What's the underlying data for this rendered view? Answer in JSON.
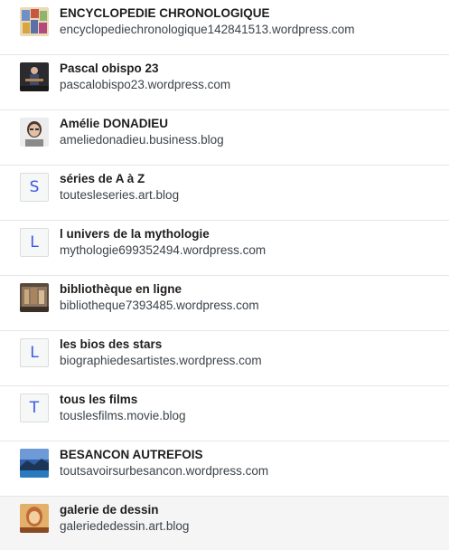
{
  "sites": [
    {
      "title": "ENCYCLOPEDIE CHRONOLOGIQUE",
      "url": "encyclopediechronologique142841513.wordpress.com",
      "thumb": "image",
      "thumb_name": "encyclopedie-thumbnail"
    },
    {
      "title": "Pascal obispo 23",
      "url": "pascalobispo23.wordpress.com",
      "thumb": "image",
      "thumb_name": "guitarist-thumbnail"
    },
    {
      "title": "Amélie DONADIEU",
      "url": "ameliedonadieu.business.blog",
      "thumb": "image",
      "thumb_name": "portrait-thumbnail"
    },
    {
      "title": "séries de A à Z",
      "url": "toutesleseries.art.blog",
      "thumb": "letter",
      "letter": "S"
    },
    {
      "title": "l univers de la mythologie",
      "url": "mythologie699352494.wordpress.com",
      "thumb": "letter",
      "letter": "L"
    },
    {
      "title": "bibliothèque en ligne",
      "url": "bibliotheque7393485.wordpress.com",
      "thumb": "image",
      "thumb_name": "library-thumbnail"
    },
    {
      "title": "les bios des stars",
      "url": "biographiedesartistes.wordpress.com",
      "thumb": "letter",
      "letter": "L"
    },
    {
      "title": "tous les films",
      "url": "touslesfilms.movie.blog",
      "thumb": "letter",
      "letter": "T"
    },
    {
      "title": "BESANCON AUTREFOIS",
      "url": "toutsavoirsurbesancon.wordpress.com",
      "thumb": "image",
      "thumb_name": "landscape-thumbnail"
    },
    {
      "title": "galerie de dessin",
      "url": "galeriededessin.art.blog",
      "thumb": "image",
      "thumb_name": "drawing-thumbnail"
    }
  ],
  "colors": {
    "letter_accent": "#3858e9",
    "selected_row_bg": "#f5f5f5"
  }
}
